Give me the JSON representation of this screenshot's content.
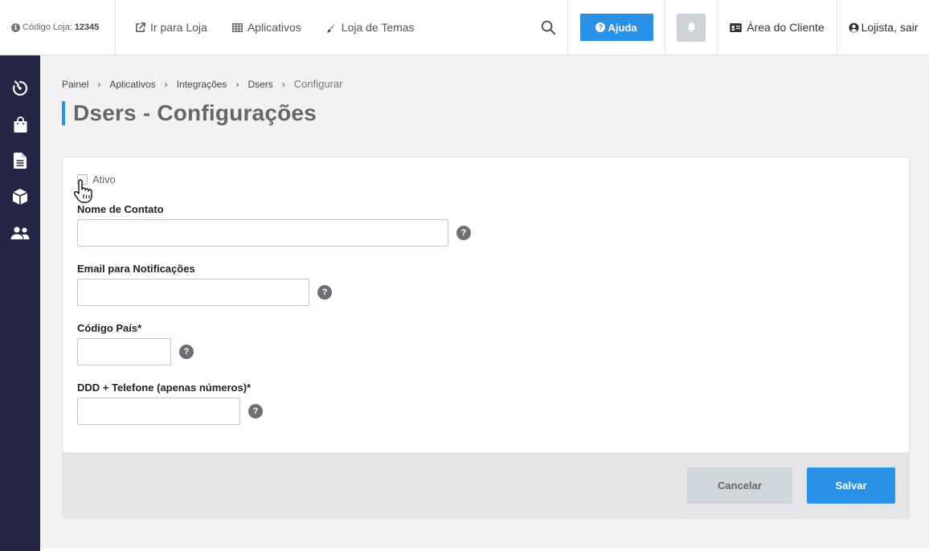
{
  "topbar": {
    "store_code_label": "Código Loja:",
    "store_code_value": "12345",
    "nav": [
      {
        "label": "Ir para Loja",
        "icon": "external-link-icon"
      },
      {
        "label": "Aplicativos",
        "icon": "grid-icon"
      },
      {
        "label": "Loja de Temas",
        "icon": "brush-icon"
      }
    ],
    "help_label": "Ajuda",
    "client_area_label": "Área do Cliente",
    "logout_label": "Lojista, sair"
  },
  "sidebar": {
    "items": [
      {
        "icon": "dashboard-timer-icon"
      },
      {
        "icon": "shopping-bag-icon"
      },
      {
        "icon": "document-icon"
      },
      {
        "icon": "box-icon"
      },
      {
        "icon": "users-icon"
      }
    ]
  },
  "breadcrumb": [
    "Painel",
    "Aplicativos",
    "Integrações",
    "Dsers",
    "Configurar"
  ],
  "page": {
    "title": "Dsers - Configurações"
  },
  "form": {
    "active_label": "Ativo",
    "active_checked": false,
    "fields": [
      {
        "label": "Nome de Contato",
        "value": "",
        "placeholder": ""
      },
      {
        "label": "Email para Notificações",
        "value": "",
        "placeholder": ""
      },
      {
        "label": "Código País*",
        "value": "",
        "placeholder": ""
      },
      {
        "label": "DDD + Telefone (apenas números)*",
        "value": "",
        "placeholder": ""
      }
    ],
    "help_glyph": "?",
    "cancel_label": "Cancelar",
    "save_label": "Salvar"
  },
  "colors": {
    "accent": "#2b91e6",
    "sidebar": "#252547",
    "footer": "#e5e5e7",
    "cancel": "#cfd6dc"
  }
}
